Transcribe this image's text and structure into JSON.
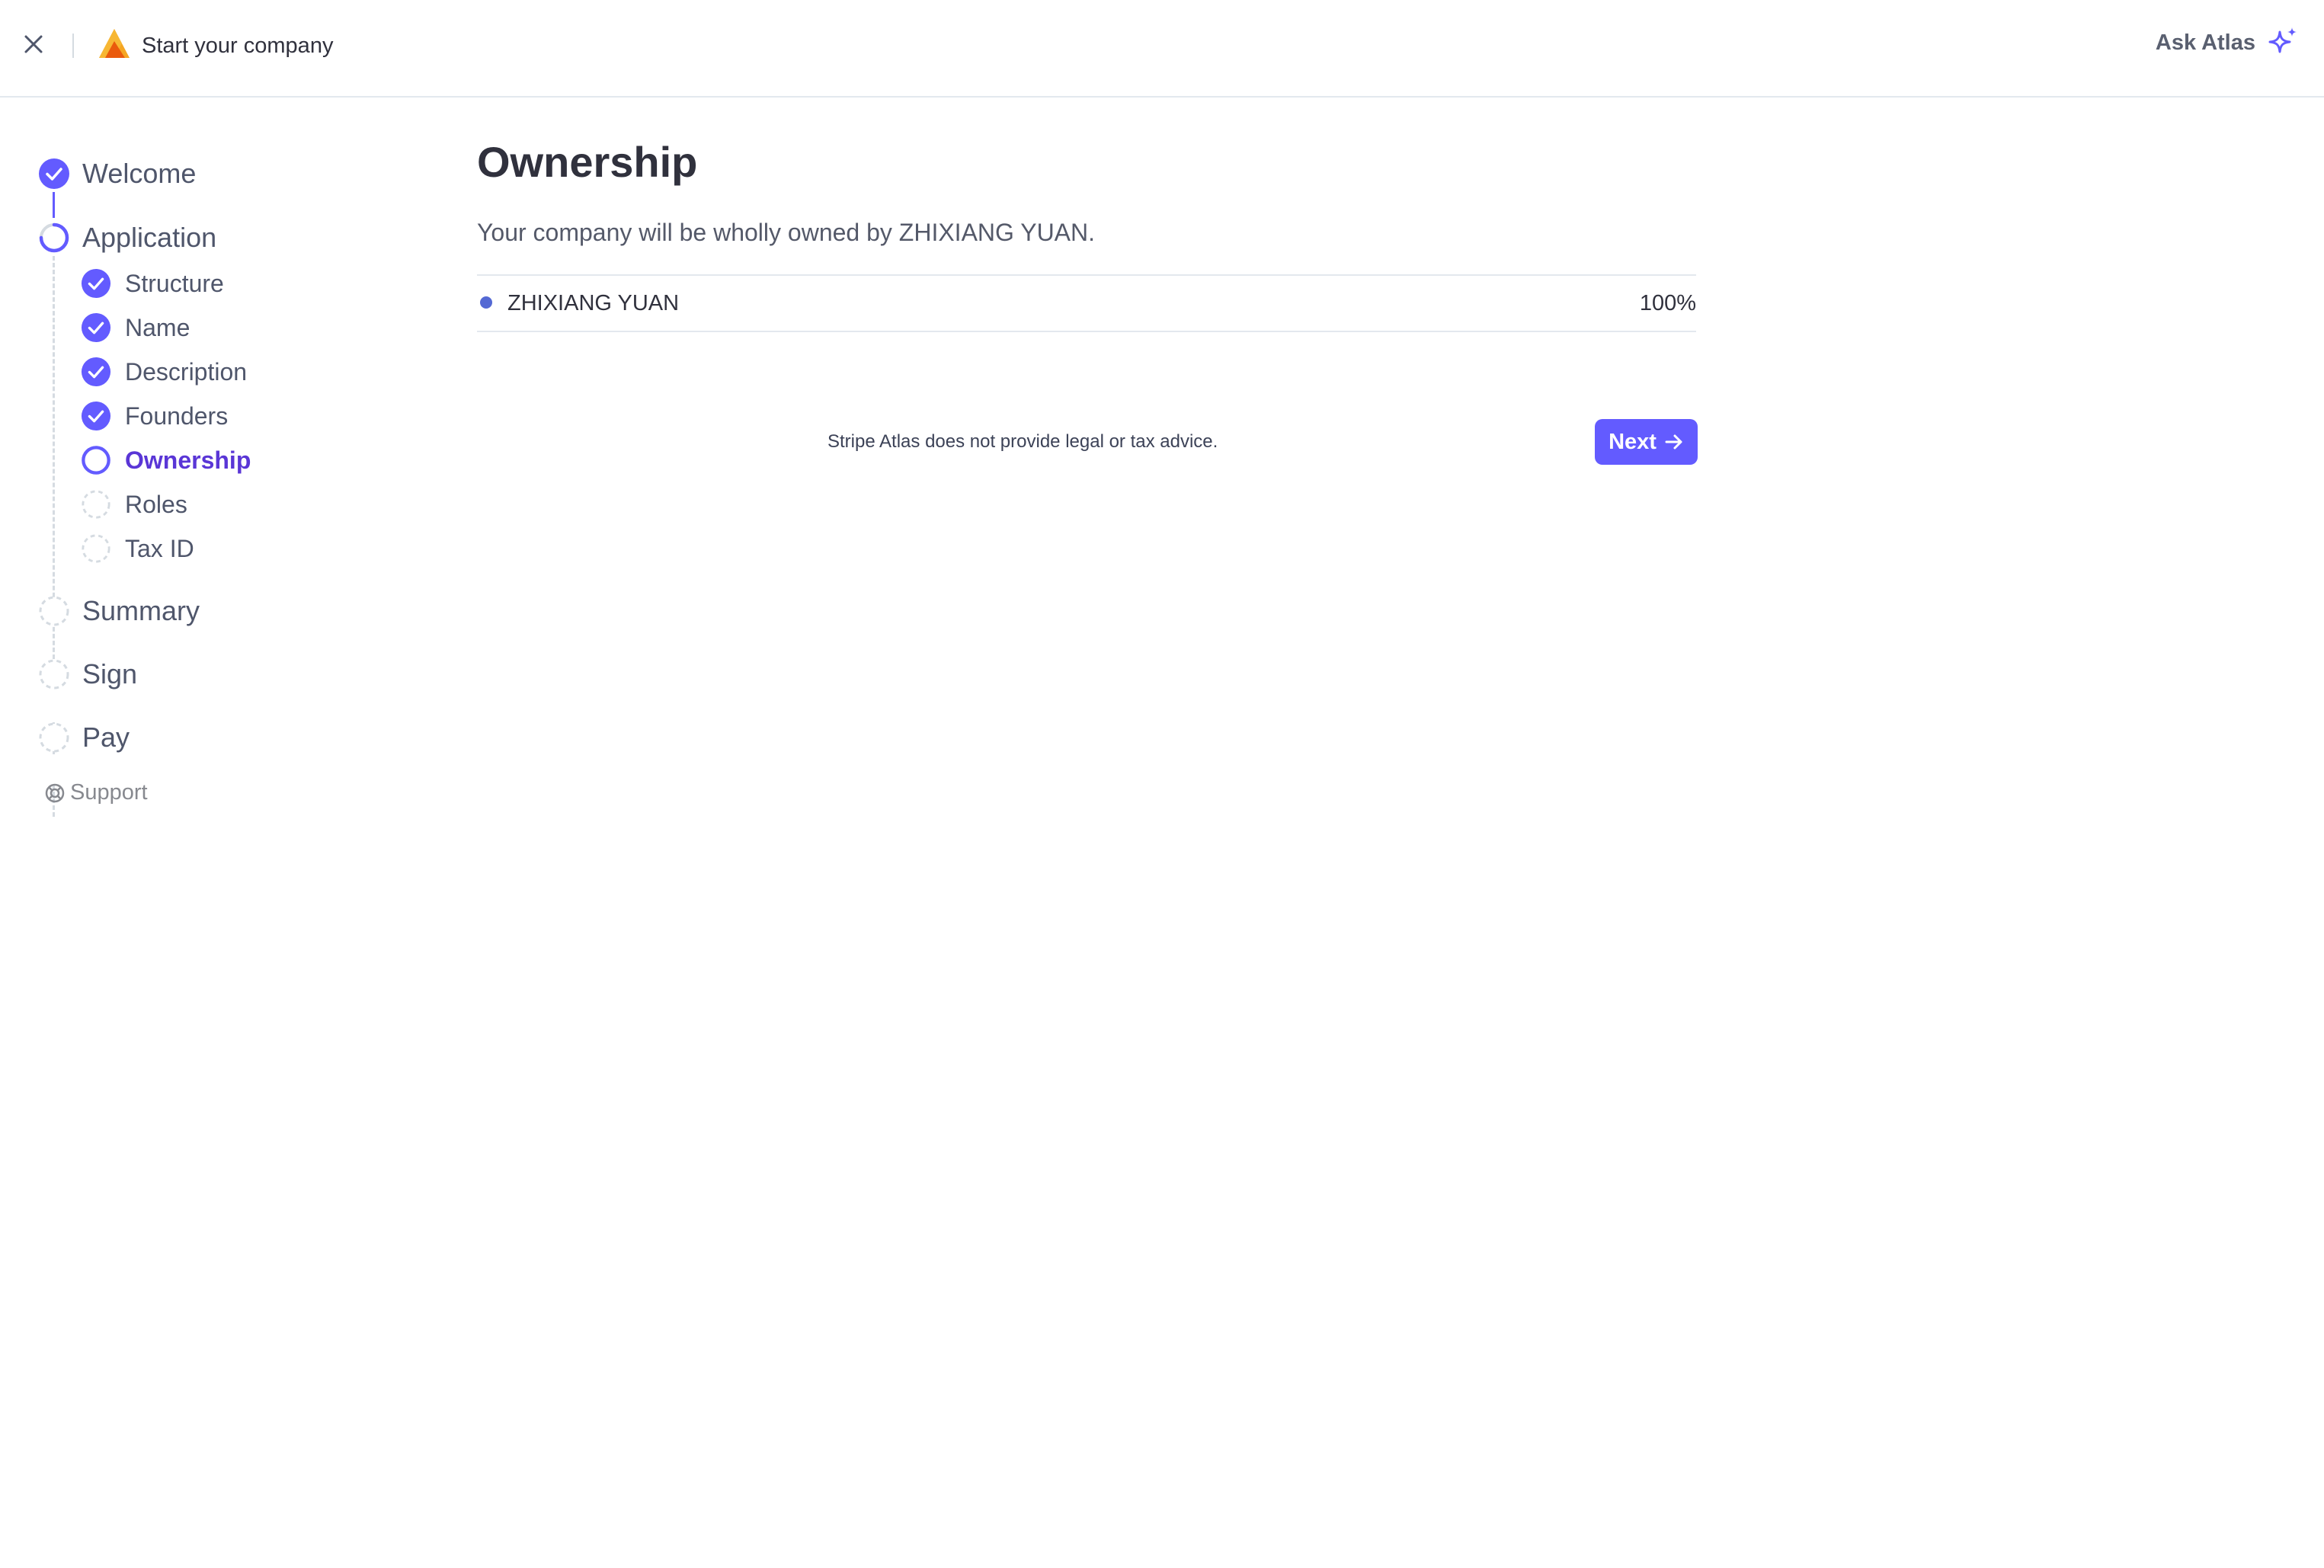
{
  "header": {
    "title": "Start your company",
    "ask_label": "Ask Atlas",
    "icons": {
      "close": "close-icon",
      "logo": "atlas-logo",
      "ask": "sparkle-icon"
    }
  },
  "sidebar": {
    "steps": [
      {
        "label": "Welcome",
        "state": "complete"
      },
      {
        "label": "Application",
        "state": "in-progress"
      },
      {
        "label": "Summary",
        "state": "pending"
      },
      {
        "label": "Sign",
        "state": "pending"
      },
      {
        "label": "Pay",
        "state": "pending"
      }
    ],
    "substeps": [
      {
        "label": "Structure",
        "state": "complete"
      },
      {
        "label": "Name",
        "state": "complete"
      },
      {
        "label": "Description",
        "state": "complete"
      },
      {
        "label": "Founders",
        "state": "complete"
      },
      {
        "label": "Ownership",
        "state": "current"
      },
      {
        "label": "Roles",
        "state": "pending"
      },
      {
        "label": "Tax ID",
        "state": "pending"
      }
    ],
    "support_label": "Support"
  },
  "main": {
    "title": "Ownership",
    "description": "Your company will be wholly owned by ZHIXIANG YUAN.",
    "owners": [
      {
        "name": "ZHIXIANG YUAN",
        "percent": "100%"
      }
    ],
    "disclaimer": "Stripe Atlas does not provide legal or tax advice.",
    "next_label": "Next"
  },
  "colors": {
    "accent": "#635bff",
    "accent_text": "#5a36d6",
    "logo_orange": "#f5a623",
    "logo_red": "#ea5a0c",
    "pending_stroke": "#d5dbe1"
  }
}
